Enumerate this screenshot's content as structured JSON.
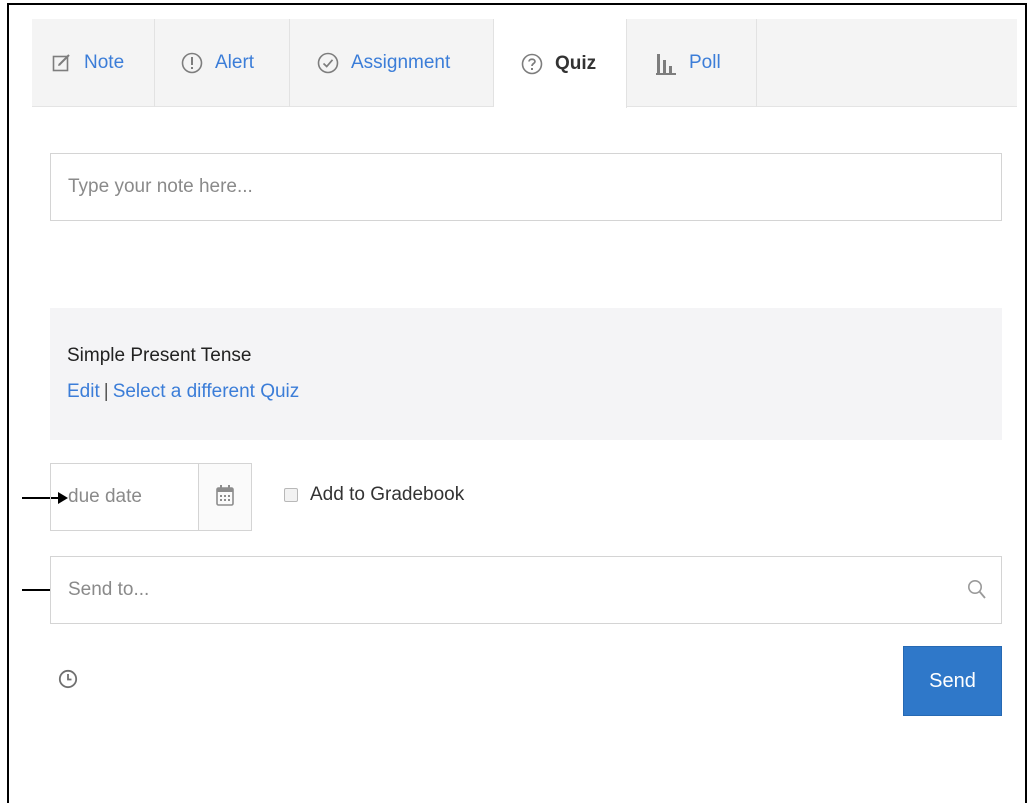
{
  "tabs": [
    {
      "id": "note",
      "label": "Note",
      "icon": "note-edit-icon"
    },
    {
      "id": "alert",
      "label": "Alert",
      "icon": "alert-icon"
    },
    {
      "id": "assignment",
      "label": "Assignment",
      "icon": "check-circle-icon"
    },
    {
      "id": "quiz",
      "label": "Quiz",
      "icon": "question-circle-icon",
      "active": true
    },
    {
      "id": "poll",
      "label": "Poll",
      "icon": "bar-chart-icon"
    }
  ],
  "note_input": {
    "placeholder": "Type your note here..."
  },
  "quiz": {
    "title": "Simple Present Tense",
    "edit_label": "Edit",
    "separator": "|",
    "select_label": "Select a different Quiz"
  },
  "due_date": {
    "placeholder": "due date",
    "icon": "calendar-icon"
  },
  "gradebook": {
    "label": "Add to Gradebook",
    "checked": false
  },
  "send_to": {
    "placeholder": "Send to...",
    "icon": "search-icon"
  },
  "footer": {
    "schedule_icon": "clock-icon",
    "send_label": "Send"
  },
  "colors": {
    "accent": "#2f78c9",
    "link": "#3b7dd8",
    "panel_bg": "#f4f4f6",
    "tabbar_bg": "#f4f4f4"
  }
}
